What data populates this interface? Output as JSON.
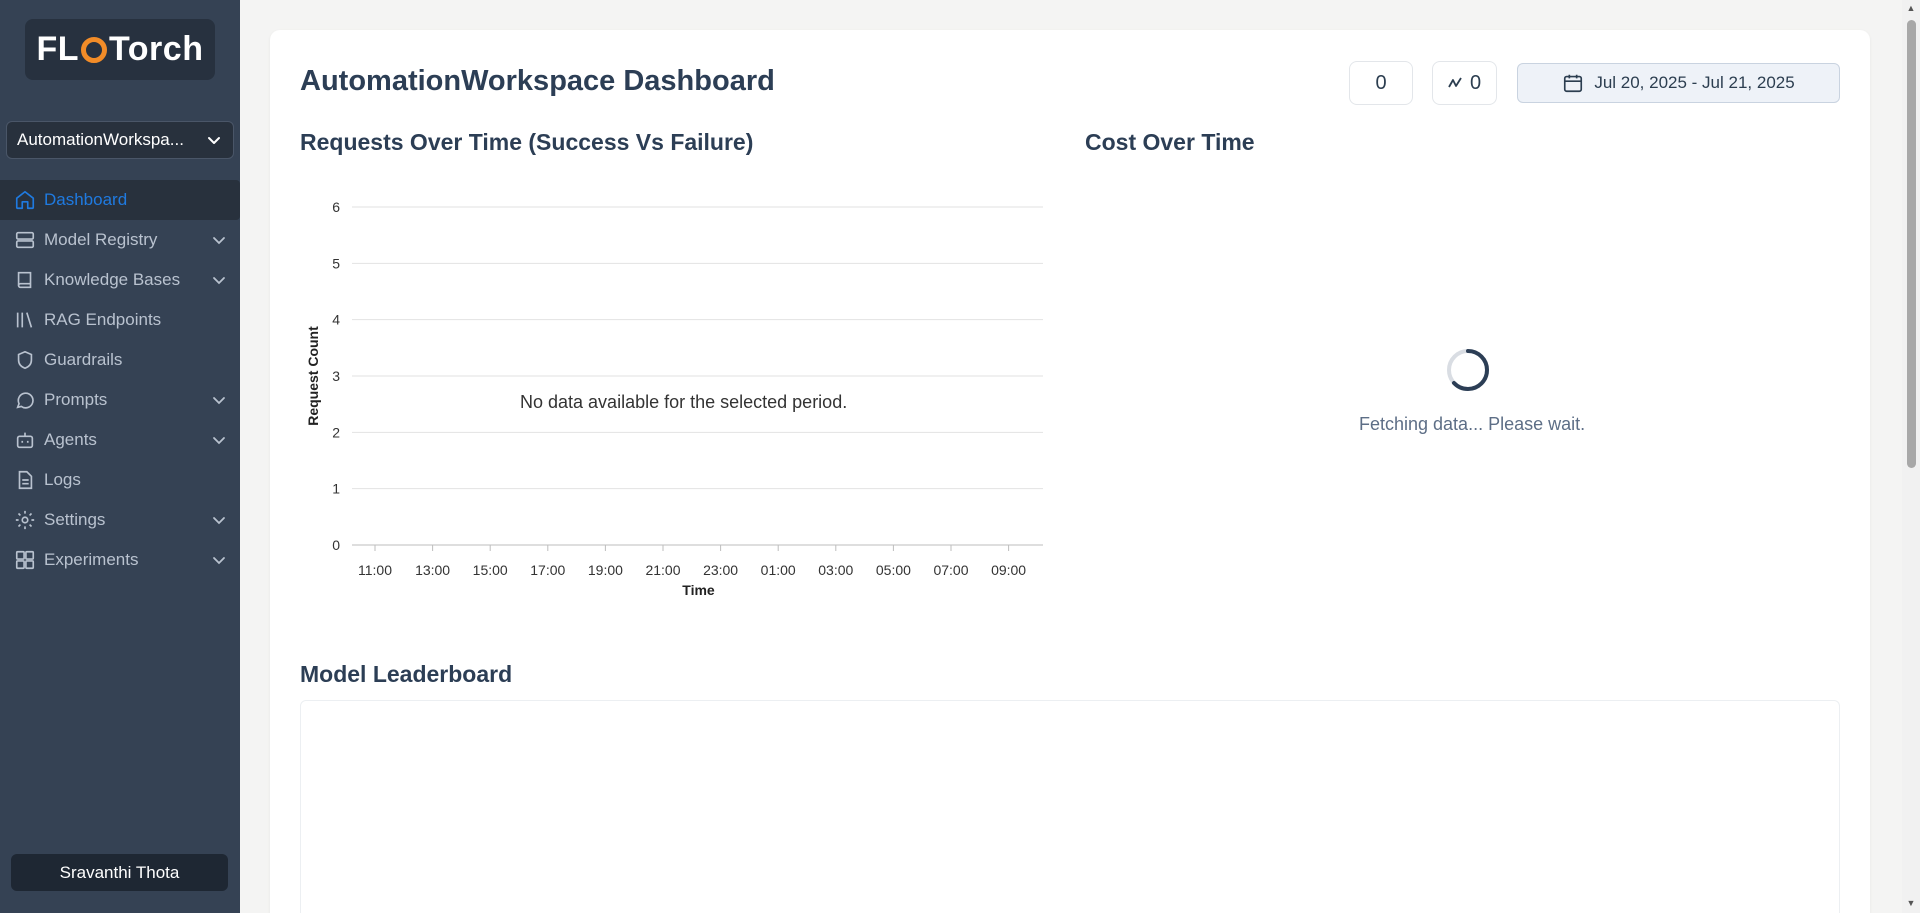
{
  "sidebar": {
    "logo_text_left": "FL",
    "logo_text_right": "Torch",
    "workspace": "AutomationWorkspa...",
    "items": [
      {
        "label": "Dashboard",
        "icon": "home-icon",
        "active": true,
        "expandable": false
      },
      {
        "label": "Model Registry",
        "icon": "server-icon",
        "active": false,
        "expandable": true
      },
      {
        "label": "Knowledge Bases",
        "icon": "book-icon",
        "active": false,
        "expandable": true
      },
      {
        "label": "RAG Endpoints",
        "icon": "library-icon",
        "active": false,
        "expandable": false
      },
      {
        "label": "Guardrails",
        "icon": "shield-icon",
        "active": false,
        "expandable": false
      },
      {
        "label": "Prompts",
        "icon": "message-circle-icon",
        "active": false,
        "expandable": true
      },
      {
        "label": "Agents",
        "icon": "bot-icon",
        "active": false,
        "expandable": true
      },
      {
        "label": "Logs",
        "icon": "file-text-icon",
        "active": false,
        "expandable": false
      },
      {
        "label": "Settings",
        "icon": "gear-icon",
        "active": false,
        "expandable": true
      },
      {
        "label": "Experiments",
        "icon": "layout-grid-icon",
        "active": false,
        "expandable": true
      }
    ],
    "user": "Sravanthi Thota"
  },
  "header": {
    "title": "AutomationWorkspace Dashboard",
    "stat1": "0",
    "stat2": "0",
    "date_range": "Jul 20, 2025 - Jul 21, 2025"
  },
  "requests_chart": {
    "title": "Requests Over Time (Success Vs Failure)",
    "empty_message": "No data available for the selected period."
  },
  "cost_chart": {
    "title": "Cost Over Time",
    "loading_message": "Fetching data... Please wait."
  },
  "leaderboard": {
    "title": "Model Leaderboard"
  },
  "colors": {
    "sidebar_bg": "#354254",
    "active": "#1f7ae0",
    "logo_accent": "#f28c28"
  },
  "chart_data": {
    "type": "line",
    "title": "Requests Over Time (Success Vs Failure)",
    "xlabel": "Time",
    "ylabel": "Request Count",
    "categories": [
      "11:00",
      "13:00",
      "15:00",
      "17:00",
      "19:00",
      "21:00",
      "23:00",
      "01:00",
      "03:00",
      "05:00",
      "07:00",
      "09:00"
    ],
    "y_ticks": [
      "0",
      "1",
      "2",
      "3",
      "4",
      "5",
      "6"
    ],
    "ylim": [
      0,
      6
    ],
    "series": [],
    "grid": true
  }
}
